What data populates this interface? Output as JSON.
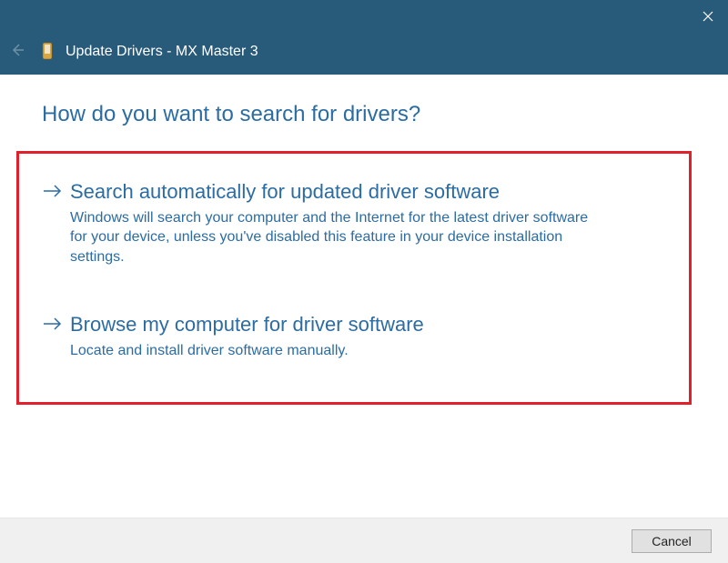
{
  "window": {
    "title": "Update Drivers - MX Master 3"
  },
  "heading": "How do you want to search for drivers?",
  "options": [
    {
      "title": "Search automatically for updated driver software",
      "description": "Windows will search your computer and the Internet for the latest driver software for your device, unless you've disabled this feature in your device installation settings."
    },
    {
      "title": "Browse my computer for driver software",
      "description": "Locate and install driver software manually."
    }
  ],
  "footer": {
    "cancel": "Cancel"
  }
}
